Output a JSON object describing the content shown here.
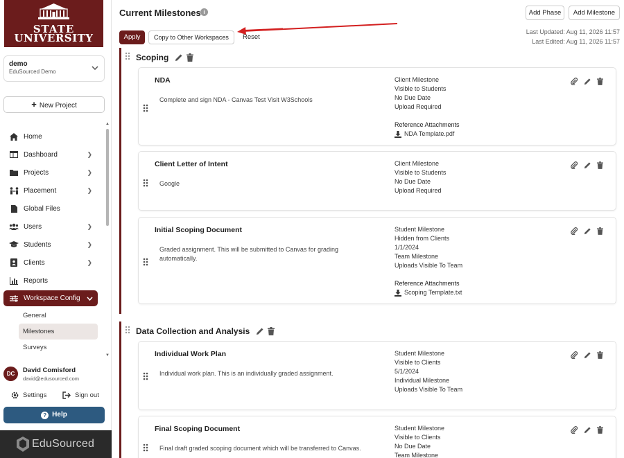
{
  "brand": {
    "line1": "STATE",
    "line2": "UNIVERSITY",
    "footer": "EduSourced"
  },
  "workspace": {
    "name": "demo",
    "subtitle": "EduSourced Demo"
  },
  "new_project_label": "New Project",
  "nav": {
    "home": "Home",
    "dashboard": "Dashboard",
    "projects": "Projects",
    "placement": "Placement",
    "global_files": "Global Files",
    "users": "Users",
    "students": "Students",
    "clients": "Clients",
    "reports": "Reports",
    "workspace_config": "Workspace Config",
    "sub": {
      "general": "General",
      "milestones": "Milestones",
      "surveys": "Surveys"
    }
  },
  "user": {
    "initials": "DC",
    "name": "David Comisford",
    "email": "david@edusourced.com"
  },
  "settings_label": "Settings",
  "signout_label": "Sign out",
  "help_label": "Help",
  "main": {
    "title": "Current Milestones",
    "add_phase": "Add Phase",
    "add_milestone": "Add Milestone",
    "apply": "Apply",
    "copy": "Copy to Other Workspaces",
    "reset": "Reset",
    "last_updated": "Last Updated: Aug 11, 2026 11:57",
    "last_edited": "Last Edited: Aug 11, 2026 11:57"
  },
  "phases": [
    {
      "title": "Scoping",
      "milestones": [
        {
          "title": "NDA",
          "desc": "Complete and sign NDA - Canvas Test Visit W3Schools",
          "meta": [
            "Client Milestone",
            "Visible to Students",
            "No Due Date",
            "Upload Required"
          ],
          "attach_header": "Reference Attachments",
          "attachment": "NDA Template.pdf"
        },
        {
          "title": "Client Letter of Intent",
          "desc": "Google",
          "meta": [
            "Client Milestone",
            "Visible to Students",
            "No Due Date",
            "Upload Required"
          ]
        },
        {
          "title": "Initial Scoping Document",
          "desc": "Graded assignment. This will be submitted to Canvas for grading automatically.",
          "meta": [
            "Student Milestone",
            "Hidden from Clients",
            "1/1/2024",
            "Team Milestone",
            "Uploads Visible To Team"
          ],
          "attach_header": "Reference Attachments",
          "attachment": "Scoping Template.txt"
        }
      ]
    },
    {
      "title": "Data Collection and Analysis",
      "milestones": [
        {
          "title": "Individual Work Plan",
          "desc": "Individual work plan. This is an individually graded assignment.",
          "meta": [
            "Student Milestone",
            "Visible to Clients",
            "5/1/2024",
            "Individual Milestone",
            "Uploads Visible To Team"
          ]
        },
        {
          "title": "Final Scoping Document",
          "desc": "Final draft graded scoping document which will be transferred to Canvas.",
          "meta": [
            "Student Milestone",
            "Visible to Clients",
            "No Due Date",
            "Team Milestone"
          ]
        }
      ]
    }
  ],
  "colors": {
    "brand": "#6b1c1c",
    "help": "#2d5a80",
    "arrow": "#d32020"
  }
}
